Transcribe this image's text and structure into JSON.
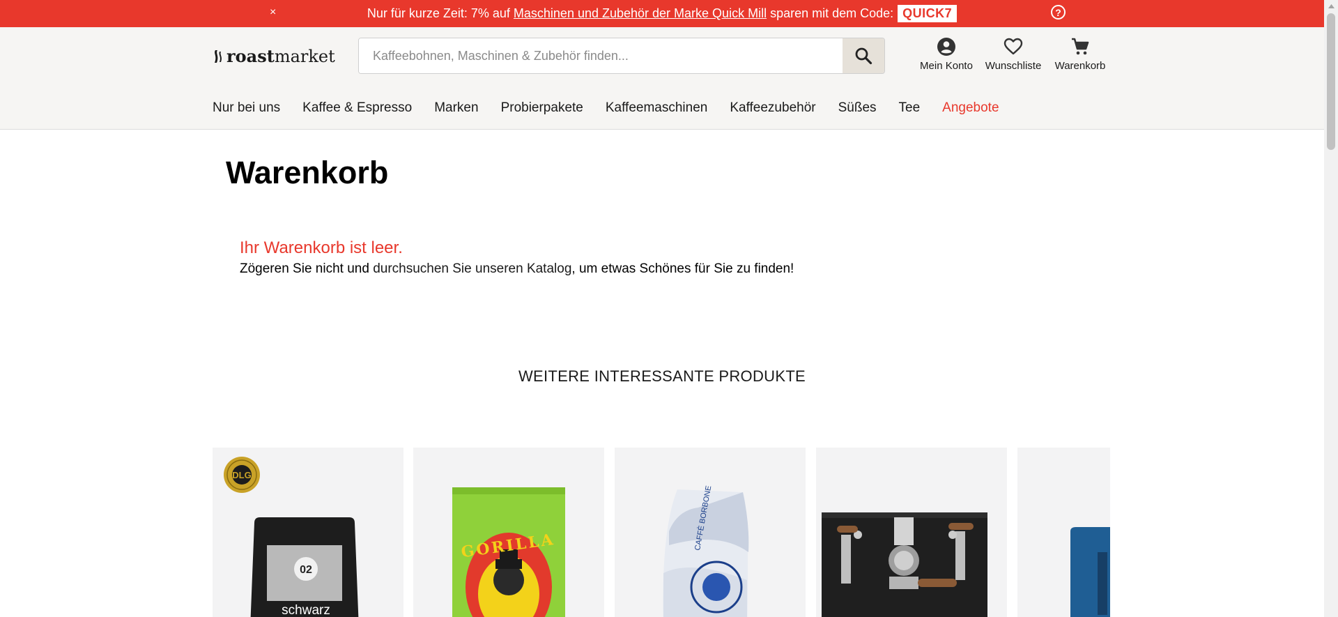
{
  "promo": {
    "close_label": "×",
    "text_before": "Nur für kurze Zeit: 7% auf",
    "link_text": "Maschinen und Zubehör der Marke Quick Mill",
    "text_after": "sparen mit dem Code:",
    "code": "QUICK7",
    "help_label": "?"
  },
  "header": {
    "logo": {
      "bold": "roast",
      "regular": "market"
    },
    "search": {
      "placeholder": "Kaffeebohnen, Maschinen & Zubehör finden...",
      "button_icon": "search-icon"
    },
    "account": [
      {
        "label": "Mein Konto",
        "icon": "account-icon"
      },
      {
        "label": "Wunschliste",
        "icon": "heart-icon"
      },
      {
        "label": "Warenkorb",
        "icon": "cart-icon"
      }
    ],
    "nav": [
      "Nur bei uns",
      "Kaffee & Espresso",
      "Marken",
      "Probierpakete",
      "Kaffeemaschinen",
      "Kaffeezubehör",
      "Süßes",
      "Tee",
      "Angebote"
    ]
  },
  "main": {
    "title": "Warenkorb",
    "empty_title": "Ihr Warenkorb ist leer.",
    "empty_text_before": "Zögeren Sie nicht und",
    "empty_link": "durchsuchen Sie unseren Katalog",
    "empty_text_after": ", um etwas Schönes für Sie zu finden!",
    "related_heading": "WEITERE INTERESSANTE PRODUKTE"
  },
  "products": [
    {
      "badge": "DLG",
      "pack_number": "02",
      "pack_label": "schwarz"
    },
    {
      "pack_label": "GORILLA"
    },
    {
      "pack_label": "CAFFÈ BORBONE"
    },
    {
      "pack_label": ""
    },
    {
      "pack_label": ""
    }
  ],
  "colors": {
    "accent": "#e8382c",
    "header_bg": "#f6f5f3",
    "search_button_bg": "#e6e1d9",
    "card_bg": "#f3f3f4"
  }
}
